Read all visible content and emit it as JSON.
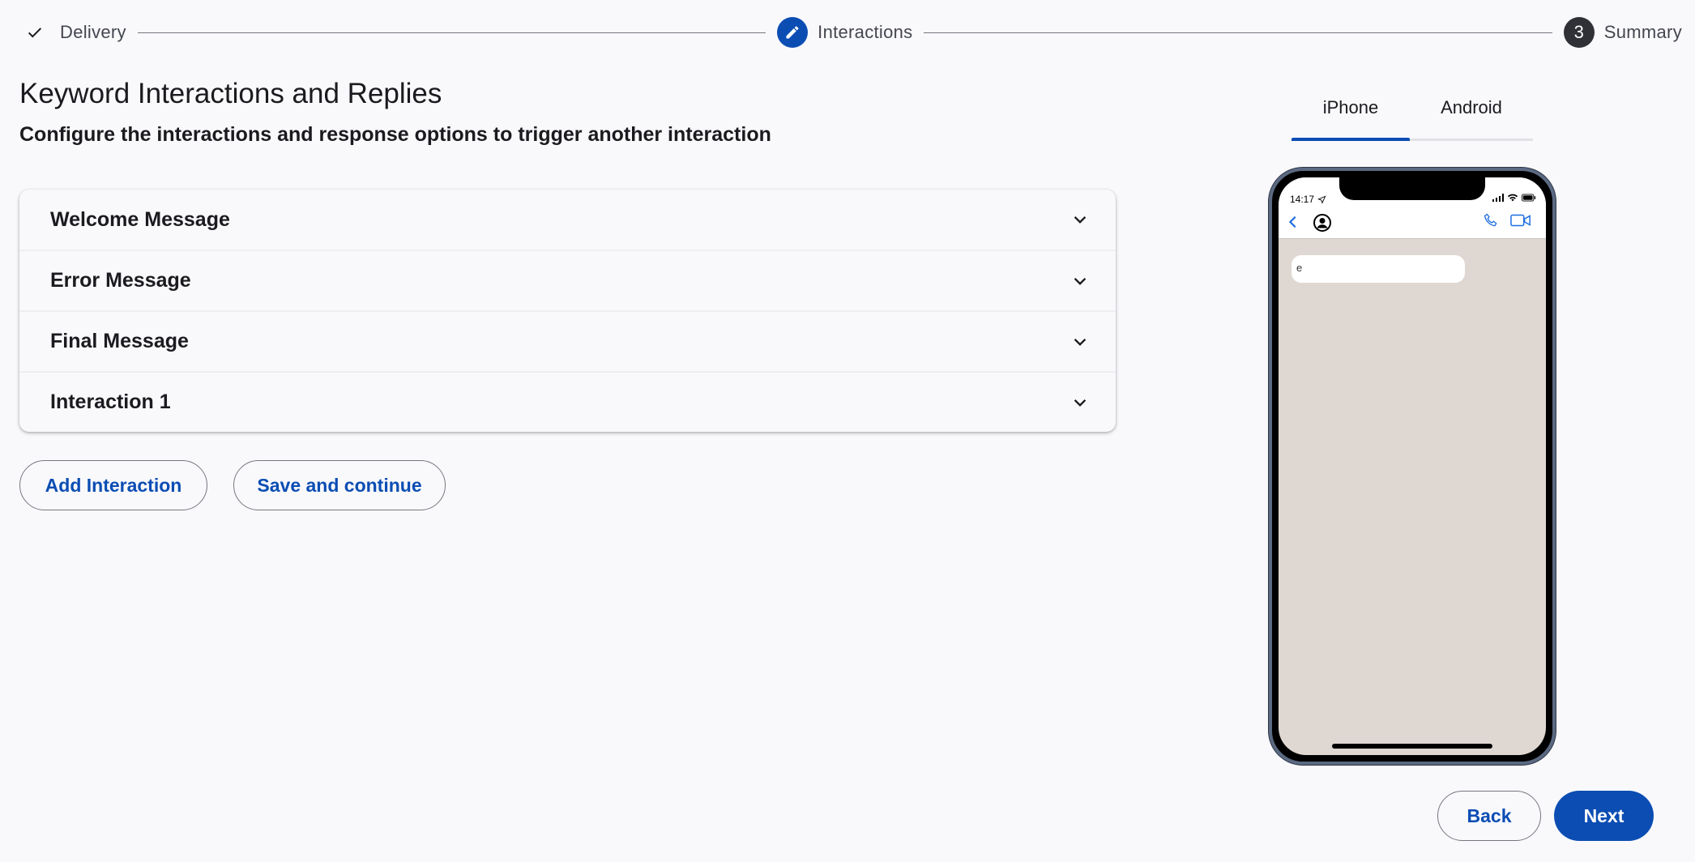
{
  "stepper": {
    "steps": [
      {
        "label": "Delivery",
        "state": "done"
      },
      {
        "label": "Interactions",
        "state": "active"
      },
      {
        "label": "Summary",
        "state": "pending",
        "number": "3"
      }
    ]
  },
  "header": {
    "title": "Keyword Interactions and Replies",
    "subtitle": "Configure the interactions and response options to trigger another interaction"
  },
  "accordion": {
    "items": [
      {
        "label": "Welcome Message"
      },
      {
        "label": "Error Message"
      },
      {
        "label": "Final Message"
      },
      {
        "label": "Interaction 1"
      }
    ]
  },
  "actions": {
    "add_label": "Add Interaction",
    "save_label": "Save and continue",
    "back_label": "Back",
    "next_label": "Next"
  },
  "preview": {
    "tabs": [
      {
        "label": "iPhone",
        "active": true
      },
      {
        "label": "Android",
        "active": false
      }
    ],
    "phone": {
      "time": "14:17",
      "bubble_text": "e"
    }
  },
  "colors": {
    "primary": "#0b4db3",
    "background": "#f9f9fc",
    "chat_background": "#dfd8d2"
  }
}
